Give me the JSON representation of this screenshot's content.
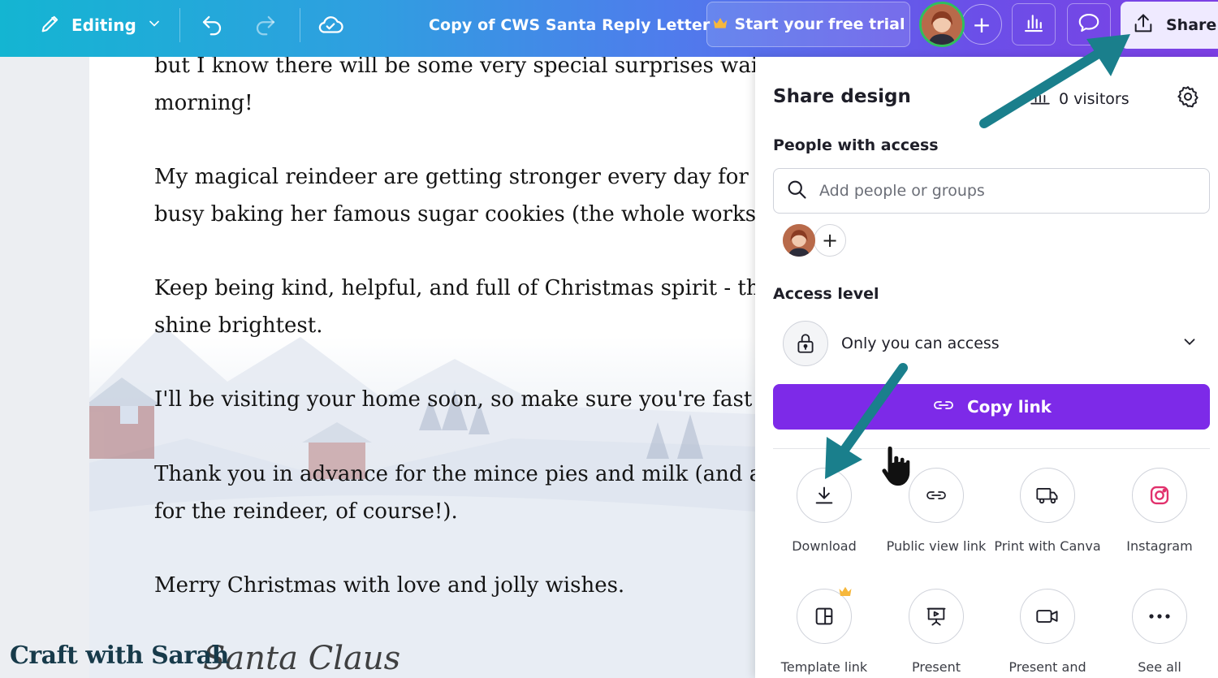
{
  "topbar": {
    "edit_label": "Editing",
    "doc_title": "Copy of CWS Santa Reply Letter",
    "trial_label": "Start your free trial",
    "share_label": "Share"
  },
  "letter": {
    "lines": [
      "but I know there will be some very special surprises waiting for",
      "morning!",
      "My magical reindeer are getting stronger every day for the big",
      "busy baking her famous sugar cookies (the whole workshop sme",
      "Keep being kind, helpful, and full of Christmas spirit - that's wh",
      "shine brightest.",
      "I'll be visiting your home soon, so make sure you're fast asleep",
      "Thank you in advance for the mince pies and milk (and a carrot",
      "for the reindeer, of course!).",
      "Merry Christmas with love and jolly wishes."
    ],
    "signature": "Santa Claus"
  },
  "watermark": "Craft with Sarah",
  "share_panel": {
    "title": "Share design",
    "visitors": "0 visitors",
    "people_label": "People with access",
    "search_placeholder": "Add people or groups",
    "access_label": "Access level",
    "access_value": "Only you can access",
    "copy_link": "Copy link",
    "options": [
      {
        "label": "Download",
        "icon": "download-icon"
      },
      {
        "label": "Public view link",
        "icon": "link-icon"
      },
      {
        "label": "Print with Canva",
        "icon": "truck-icon"
      },
      {
        "label": "Instagram",
        "icon": "instagram-icon"
      },
      {
        "label": "Template link",
        "icon": "template-icon"
      },
      {
        "label": "Present",
        "icon": "present-icon"
      },
      {
        "label": "Present and",
        "icon": "video-icon"
      },
      {
        "label": "See all",
        "icon": "more-icon"
      }
    ]
  },
  "colors": {
    "accent_purple": "#7d2ae8",
    "annotation_arrow": "#1a7f8c",
    "instagram": "#e1306c"
  }
}
